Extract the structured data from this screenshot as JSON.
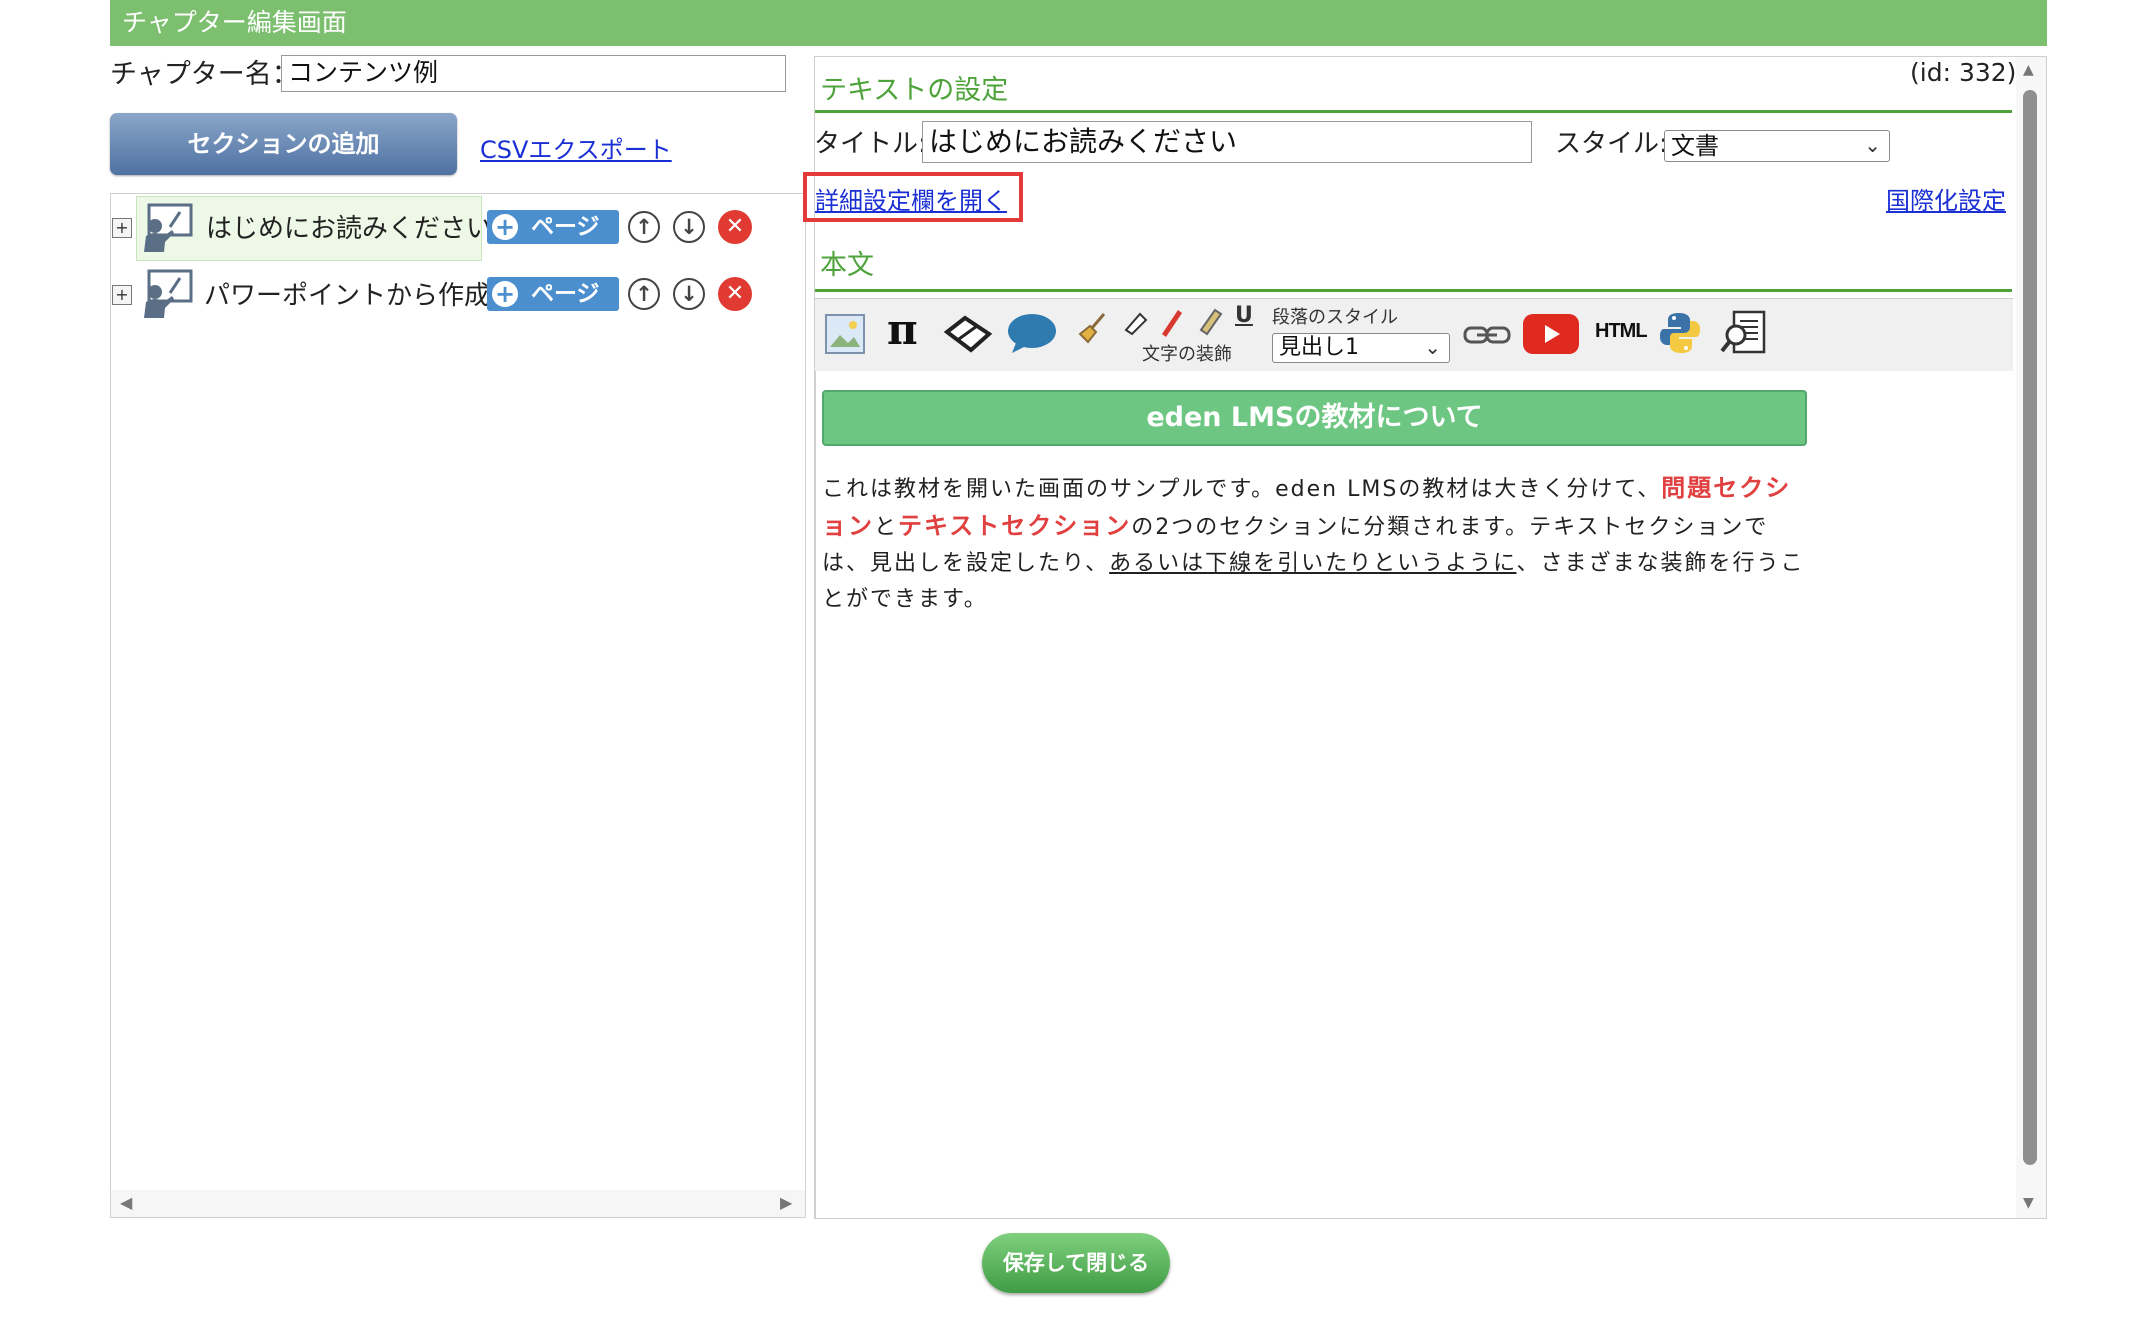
{
  "window": {
    "title": "チャプター編集画面"
  },
  "left": {
    "chapter_name_label": "チャプター名：",
    "chapter_name_value": "コンテンツ例",
    "add_section_label": "セクションの追加",
    "csv_export_label": "CSVエクスポート",
    "sections": [
      {
        "label": "はじめにお読みください",
        "page_button": "ページ",
        "expander": "+"
      },
      {
        "label": "パワーポイントから作成",
        "page_button": "ページ",
        "expander": "+"
      }
    ]
  },
  "right": {
    "id_label": "(id: 332)",
    "section_heading": "テキストの設定",
    "title_label": "タイトル:",
    "title_value": "はじめにお読みください",
    "style_label": "スタイル:",
    "style_value": "文書",
    "advanced_link": "詳細設定欄を開く",
    "i18n_link": "国際化設定",
    "body_heading": "本文",
    "toolbar": {
      "paragraph_style_label": "段落のスタイル",
      "paragraph_style_value": "見出し1",
      "text_decoration_label": "文字の装飾",
      "html_label": "HTML",
      "underline_glyph": "U",
      "pi_glyph": "π",
      "icons": [
        "image-icon",
        "pi-icon",
        "eraser-icon",
        "speech-bubble-icon",
        "broom-icon",
        "pen-icons",
        "highlighter-icon",
        "underline-icon",
        "link-icon",
        "youtube-icon",
        "html-icon",
        "python-icon",
        "search-document-icon"
      ]
    },
    "content": {
      "heading": "eden LMSの教材について",
      "p1_a": "これは教材を開いた画面のサンプルです。eden LMSの教材は大きく分けて、",
      "p1_red1": "問題セクション",
      "p1_b": "と",
      "p1_red2": "テキストセクション",
      "p1_c": "の2つのセクションに分類されます。テキストセクションでは、見出しを設定したり、",
      "p1_ul": "あるいは下線を引いたりというように",
      "p1_d": "、さまざまな装飾を行うことができます。"
    }
  },
  "footer": {
    "save_label": "保存して閉じる"
  },
  "colors": {
    "header": "#7cbf6e",
    "accent_green": "#4ea33a",
    "danger": "#e03a32",
    "link": "#1a2fd4",
    "page_button": "#4b8fcf"
  }
}
